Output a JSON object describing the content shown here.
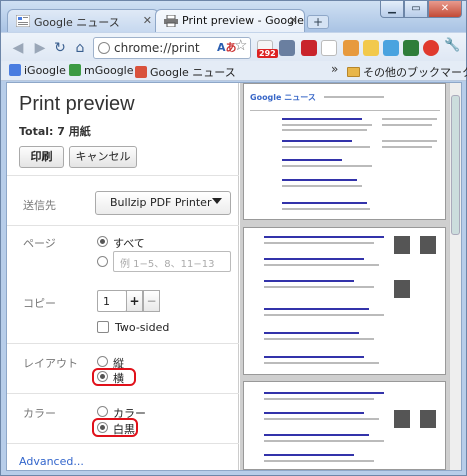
{
  "tabs": [
    {
      "label": "Google ニュース",
      "active": false
    },
    {
      "label": "Print preview - Google",
      "active": true
    }
  ],
  "new_tab_label": "+",
  "omnibox": {
    "url": "chrome://print"
  },
  "translate_label": "A",
  "extension_badge": "292",
  "bookmarks": {
    "items": [
      "iGoogle",
      "mGoogle",
      "Google ニュース"
    ],
    "overflow": "»",
    "other": "その他のブックマーク"
  },
  "print_panel": {
    "title": "Print preview",
    "total": "Total: 7 用紙",
    "print_button": "印刷",
    "cancel_button": "キャンセル",
    "destination": {
      "label": "送信先",
      "value": "Bullzip PDF Printer"
    },
    "pages": {
      "label": "ページ",
      "all": "すべて",
      "range_placeholder": "例 1−5、8、11−13"
    },
    "copies": {
      "label": "コピー",
      "value": "1",
      "plus": "+",
      "minus": "−",
      "two_sided": "Two-sided"
    },
    "layout": {
      "label": "レイアウト",
      "portrait": "縦",
      "landscape": "横",
      "selected": "landscape"
    },
    "color": {
      "label": "カラー",
      "color": "カラー",
      "bw": "白黒",
      "selected": "bw"
    },
    "advanced": "Advanced..."
  },
  "preview_pages": {
    "page1": {
      "logo": "Google ニュース"
    }
  },
  "colors": {
    "highlight": "#e0111a",
    "link": "#3366cc"
  }
}
